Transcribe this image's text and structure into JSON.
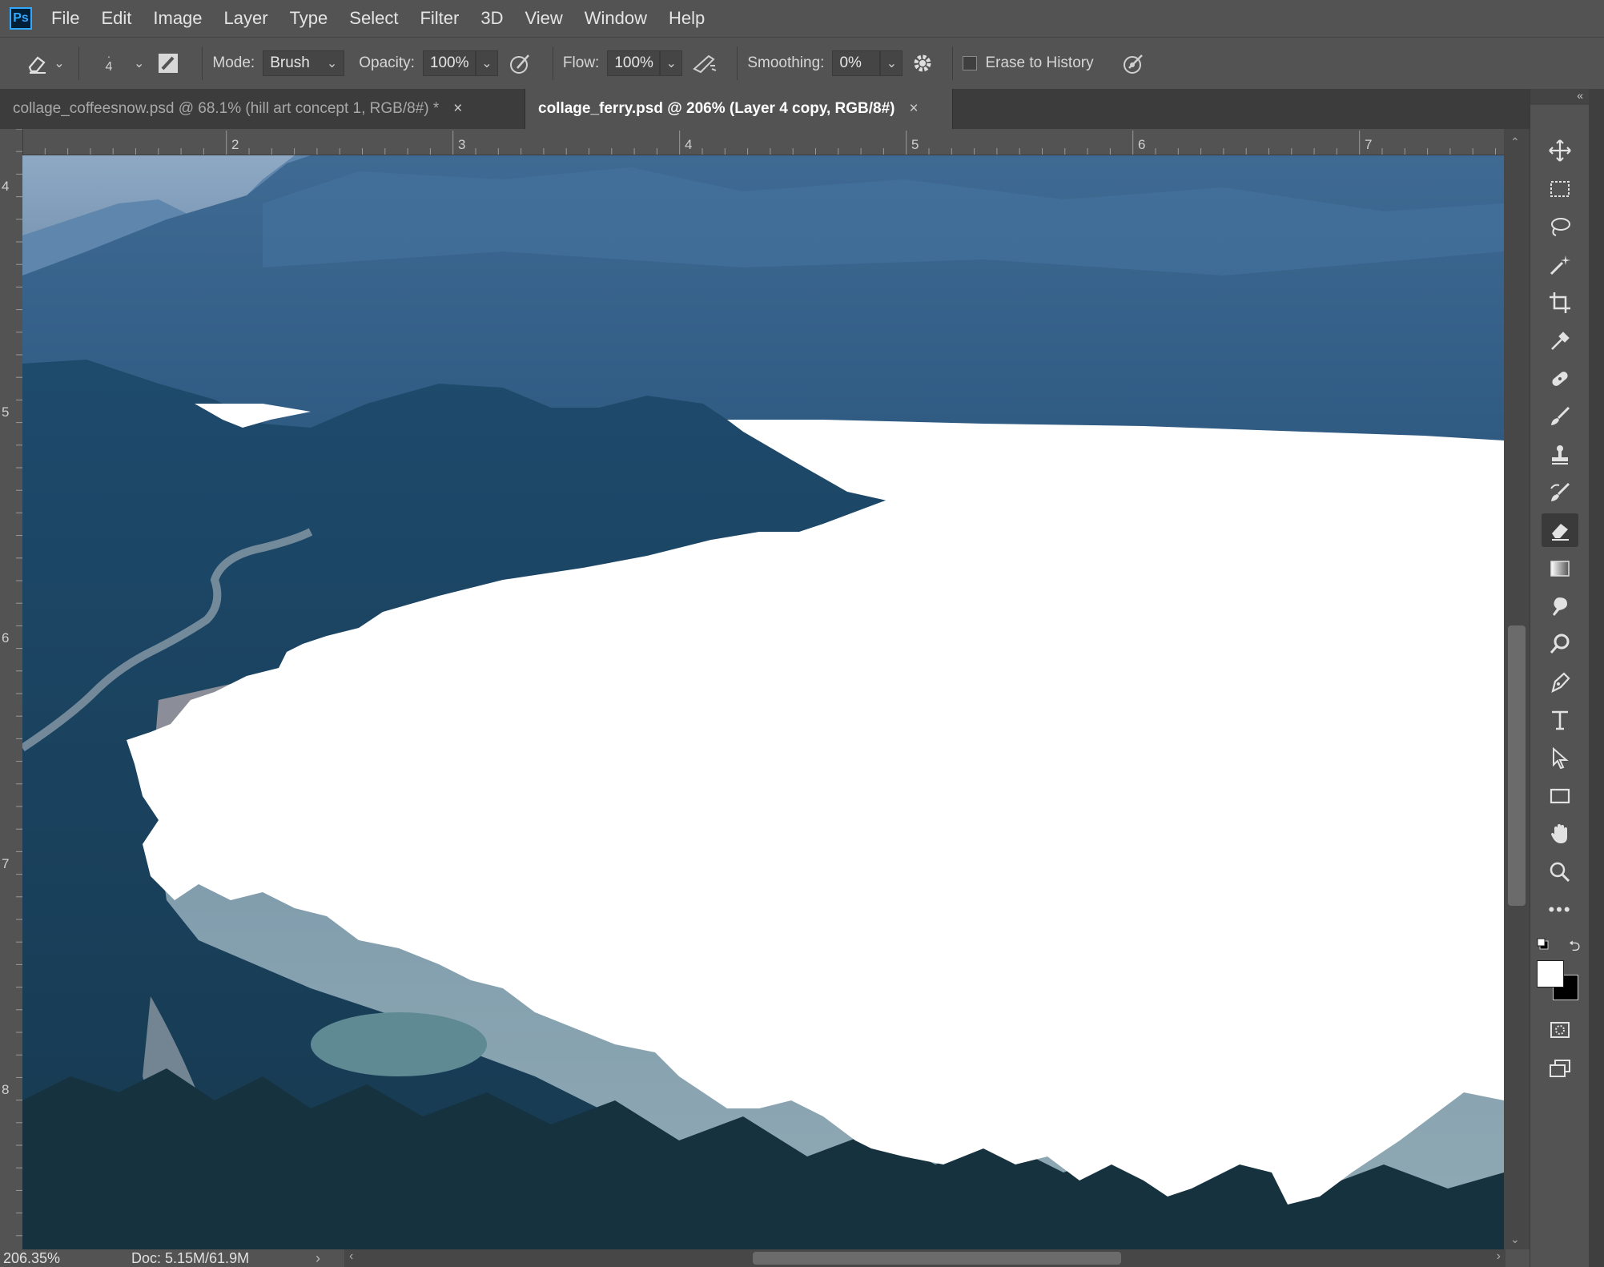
{
  "app": {
    "logo": "Ps"
  },
  "menu": [
    "File",
    "Edit",
    "Image",
    "Layer",
    "Type",
    "Select",
    "Filter",
    "3D",
    "View",
    "Window",
    "Help"
  ],
  "options": {
    "brush_size": "4",
    "mode_label": "Mode:",
    "mode_value": "Brush",
    "opacity_label": "Opacity:",
    "opacity_value": "100%",
    "flow_label": "Flow:",
    "flow_value": "100%",
    "smoothing_label": "Smoothing:",
    "smoothing_value": "0%",
    "erase_to_history_label": "Erase to History",
    "erase_to_history_checked": false
  },
  "tabs": [
    {
      "label": "collage_coffeesnow.psd @ 68.1% (hill art concept 1, RGB/8#) *",
      "active": false
    },
    {
      "label": "collage_ferry.psd @ 206% (Layer 4 copy, RGB/8#)",
      "active": true
    }
  ],
  "tab_close_glyph": "×",
  "ruler": {
    "top": [
      "2",
      "3",
      "4",
      "5",
      "6",
      "7"
    ],
    "left": [
      "4",
      "5",
      "6",
      "7",
      "8"
    ]
  },
  "status": {
    "zoom": "206.35%",
    "doc": "Doc: 5.15M/61.9M"
  },
  "tools": [
    "move-tool",
    "marquee-tool",
    "lasso-tool",
    "magic-wand-tool",
    "crop-tool",
    "eyedropper-tool",
    "healing-brush-tool",
    "brush-tool",
    "clone-stamp-tool",
    "history-brush-tool",
    "eraser-tool",
    "gradient-tool",
    "blur-tool",
    "dodge-tool",
    "pen-tool",
    "type-tool",
    "path-selection-tool",
    "rectangle-tool",
    "hand-tool",
    "zoom-tool",
    "more-tools"
  ],
  "selected_tool": "eraser-tool",
  "colors": {
    "foreground": "#ffffff",
    "background": "#000000",
    "ui_dark": "#535353",
    "accent_blue": "#31a8ff"
  }
}
